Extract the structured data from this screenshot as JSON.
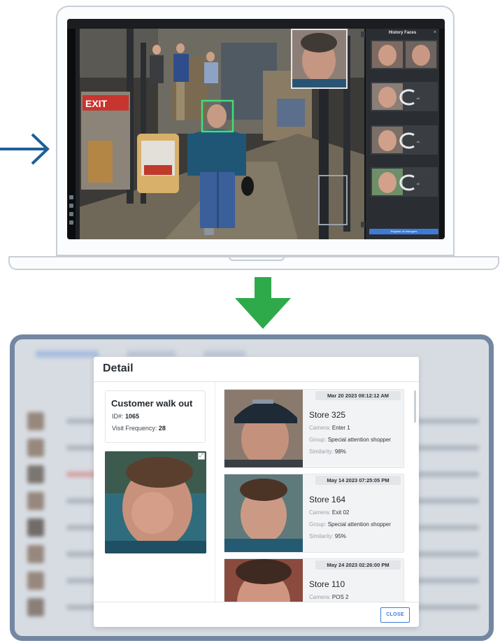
{
  "laptop": {
    "camera_caption": "",
    "history_panel_title": "History Faces",
    "register_button_label": "Register all strangers",
    "exit_sign": "EXIT"
  },
  "dialog": {
    "title": "Detail",
    "customer": {
      "name": "Customer walk out",
      "id_label": "ID#:",
      "id_value": "1065",
      "frequency_label": "Visit Frequency:",
      "frequency_value": "28"
    },
    "visits": [
      {
        "date": "Mar 20 2023 08:12:12 AM",
        "store": "Store 325",
        "camera_label": "Camera:",
        "camera": "Enter 1",
        "group_label": "Group:",
        "group": "Special attention shopper",
        "similarity_label": "Similarity:",
        "similarity": "98%"
      },
      {
        "date": "May 14 2023 07:25:05 PM",
        "store": "Store 164",
        "camera_label": "Camera:",
        "camera": "Exit 02",
        "group_label": "Group:",
        "group": "Special attention shopper",
        "similarity_label": "Similarity:",
        "similarity": "95%"
      },
      {
        "date": "May 24 2023 02:26:00 PM",
        "store": "Store 110",
        "camera_label": "Camera:",
        "camera": "POS 2"
      }
    ],
    "close_label": "CLOSE"
  },
  "colors": {
    "accent_blue": "#3d7bd6",
    "arrow_blue": "#1f5f9a",
    "arrow_green": "#2eaa4a",
    "frame_border": "#7387a3",
    "face_box": "#3ee07a"
  },
  "icons": [
    "arrow-right-icon",
    "arrow-down-icon",
    "expand-icon",
    "close-icon"
  ]
}
